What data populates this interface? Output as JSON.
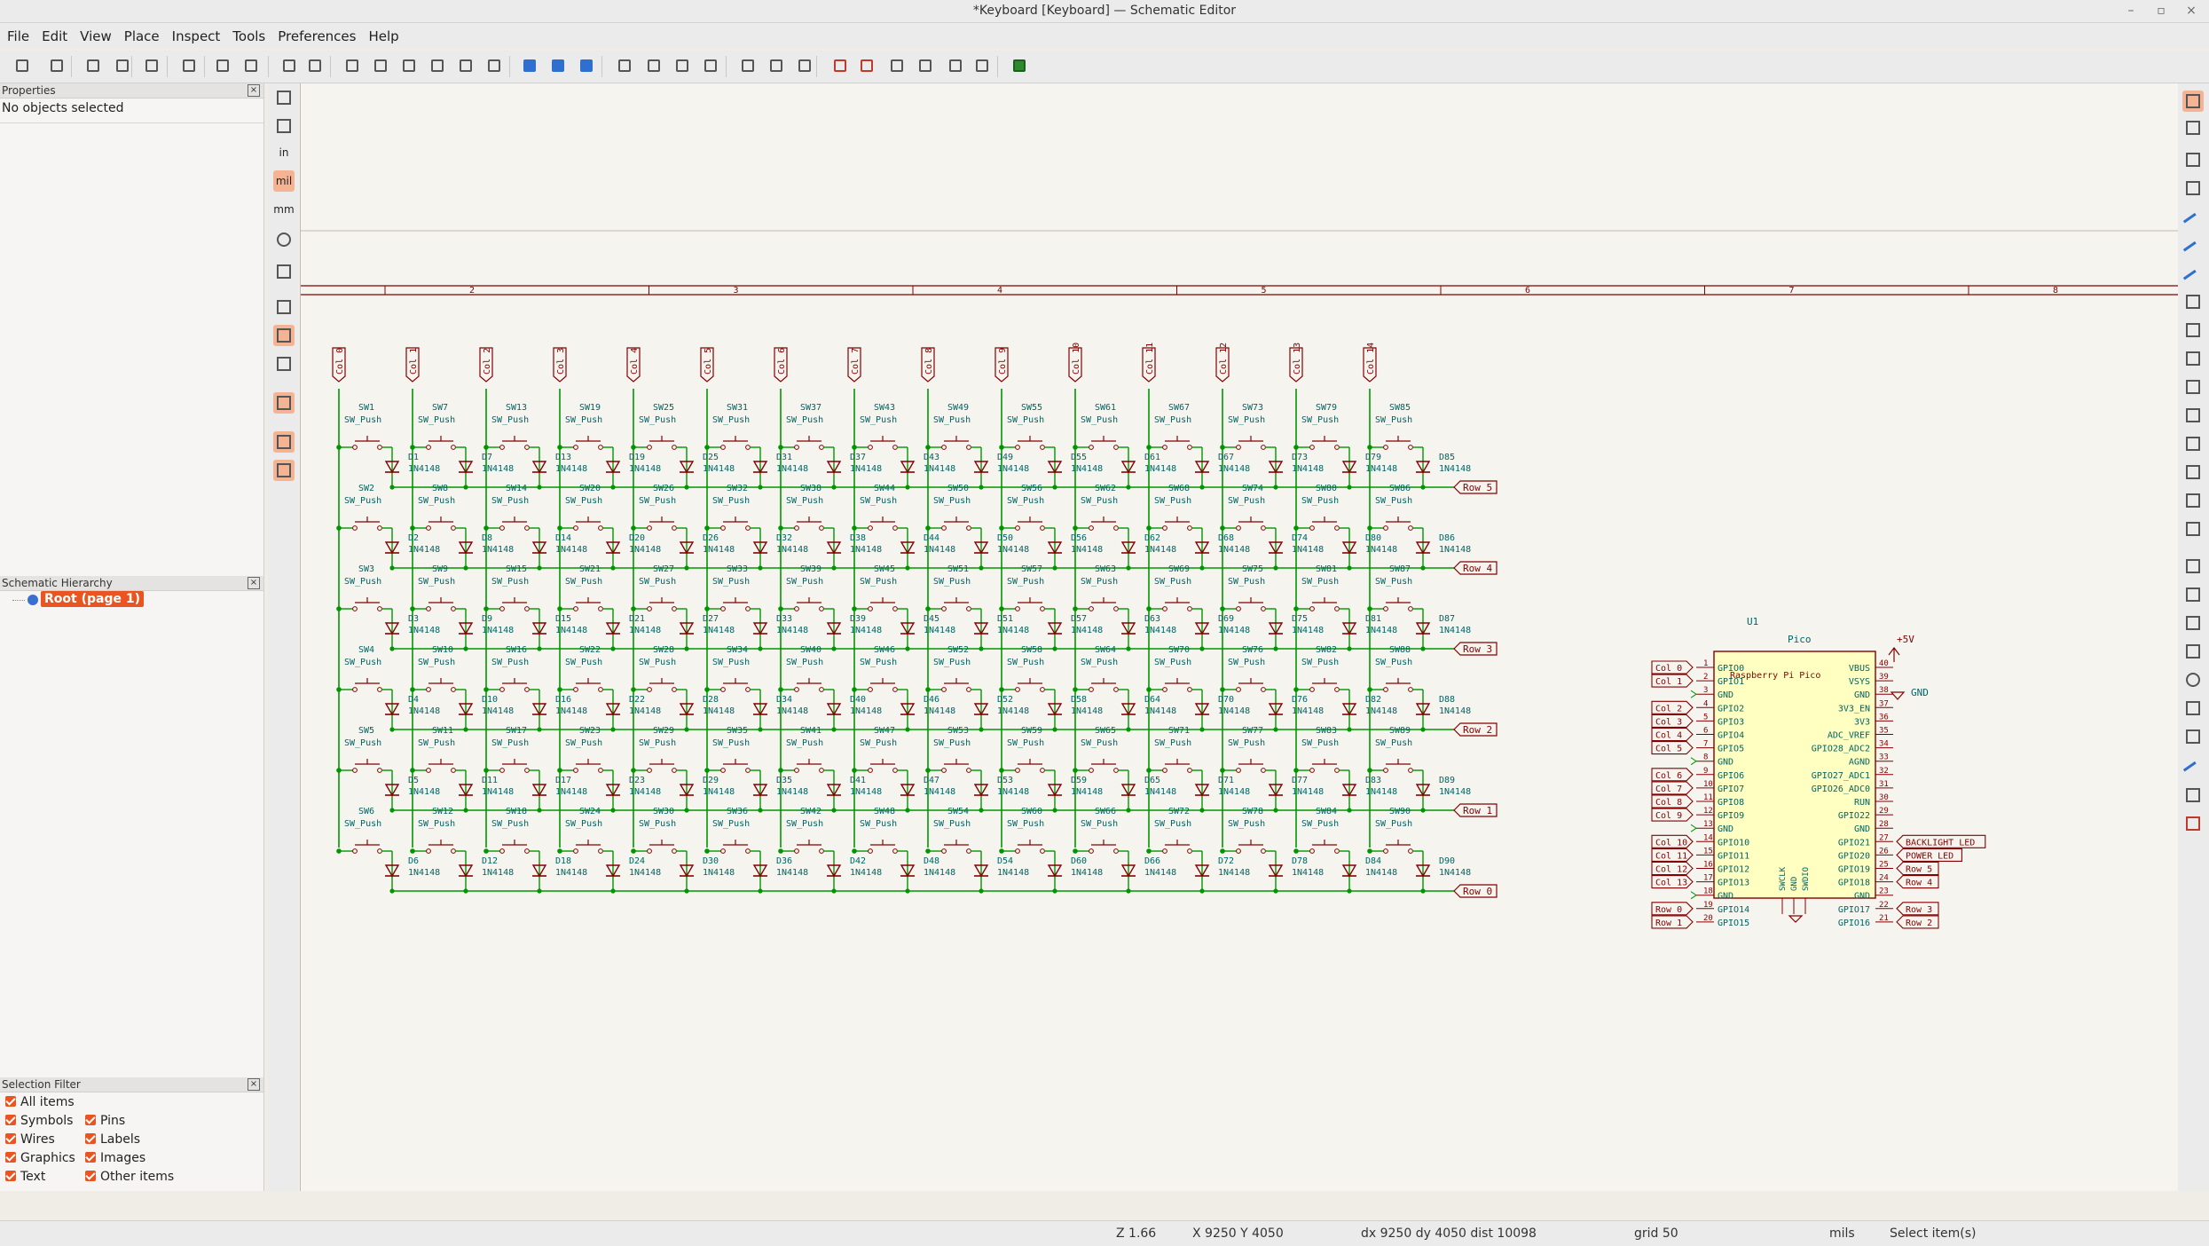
{
  "window": {
    "title": "*Keyboard [Keyboard] — Schematic Editor",
    "controls": [
      "–",
      "▫",
      "×"
    ]
  },
  "menu": [
    "File",
    "Edit",
    "View",
    "Place",
    "Inspect",
    "Tools",
    "Preferences",
    "Help"
  ],
  "properties": {
    "header": "Properties",
    "empty_text": "No objects selected"
  },
  "hierarchy": {
    "header": "Schematic Hierarchy",
    "root_label": "Root (page 1)"
  },
  "selection_filter": {
    "header": "Selection Filter",
    "items": [
      "All items",
      "Symbols",
      "Pins",
      "Wires",
      "Labels",
      "Graphics",
      "Images",
      "Text",
      "Other items"
    ]
  },
  "left_tools": {
    "units": [
      "in",
      "mil",
      "mm"
    ]
  },
  "sheet": {
    "column_labels": [
      "2",
      "3",
      "4",
      "5",
      "6",
      "7",
      "8"
    ]
  },
  "matrix": {
    "col_labels": [
      "Col 0",
      "Col 1",
      "Col 2",
      "Col 3",
      "Col 4",
      "Col 5",
      "Col 6",
      "Col 7",
      "Col 8",
      "Col 9",
      "Col 10",
      "Col 11",
      "Col 12",
      "Col 13",
      "Col 14"
    ],
    "row_labels": [
      "Row 5",
      "Row 4",
      "Row 3",
      "Row 2",
      "Row 1",
      "Row 0"
    ],
    "switch_value": "SW_Push",
    "diode_value": "1N4148"
  },
  "mcu": {
    "ref": "U1",
    "value": "Pico",
    "body_text": "Raspberry Pi Pico",
    "power_label": "+5V",
    "gnd_label": "GND",
    "left_pins": [
      {
        "num": "1",
        "name": "GPIO0",
        "net": "Col 0"
      },
      {
        "num": "2",
        "name": "GPIO1",
        "net": "Col 1"
      },
      {
        "num": "3",
        "name": "GND",
        "net": ""
      },
      {
        "num": "4",
        "name": "GPIO2",
        "net": "Col 2"
      },
      {
        "num": "5",
        "name": "GPIO3",
        "net": "Col 3"
      },
      {
        "num": "6",
        "name": "GPIO4",
        "net": "Col 4"
      },
      {
        "num": "7",
        "name": "GPIO5",
        "net": "Col 5"
      },
      {
        "num": "8",
        "name": "GND",
        "net": ""
      },
      {
        "num": "9",
        "name": "GPIO6",
        "net": "Col 6"
      },
      {
        "num": "10",
        "name": "GPIO7",
        "net": "Col 7"
      },
      {
        "num": "11",
        "name": "GPIO8",
        "net": "Col 8"
      },
      {
        "num": "12",
        "name": "GPIO9",
        "net": "Col 9"
      },
      {
        "num": "13",
        "name": "GND",
        "net": ""
      },
      {
        "num": "14",
        "name": "GPIO10",
        "net": "Col 10"
      },
      {
        "num": "15",
        "name": "GPIO11",
        "net": "Col 11"
      },
      {
        "num": "16",
        "name": "GPIO12",
        "net": "Col 12"
      },
      {
        "num": "17",
        "name": "GPIO13",
        "net": "Col 13"
      },
      {
        "num": "18",
        "name": "GND",
        "net": ""
      },
      {
        "num": "19",
        "name": "GPIO14",
        "net": "Row 0"
      },
      {
        "num": "20",
        "name": "GPIO15",
        "net": "Row 1"
      }
    ],
    "right_pins": [
      {
        "num": "40",
        "name": "VBUS",
        "net": ""
      },
      {
        "num": "39",
        "name": "VSYS",
        "net": ""
      },
      {
        "num": "38",
        "name": "GND",
        "net": ""
      },
      {
        "num": "37",
        "name": "3V3_EN",
        "net": ""
      },
      {
        "num": "36",
        "name": "3V3",
        "net": ""
      },
      {
        "num": "35",
        "name": "ADC_VREF",
        "net": ""
      },
      {
        "num": "34",
        "name": "GPIO28_ADC2",
        "net": ""
      },
      {
        "num": "33",
        "name": "AGND",
        "net": ""
      },
      {
        "num": "32",
        "name": "GPIO27_ADC1",
        "net": ""
      },
      {
        "num": "31",
        "name": "GPIO26_ADC0",
        "net": ""
      },
      {
        "num": "30",
        "name": "RUN",
        "net": ""
      },
      {
        "num": "29",
        "name": "GPIO22",
        "net": ""
      },
      {
        "num": "28",
        "name": "GND",
        "net": ""
      },
      {
        "num": "27",
        "name": "GPIO21",
        "net": "BACKLIGHT LED"
      },
      {
        "num": "26",
        "name": "GPIO20",
        "net": "POWER LED"
      },
      {
        "num": "25",
        "name": "GPIO19",
        "net": "Row 5"
      },
      {
        "num": "24",
        "name": "GPIO18",
        "net": "Row 4"
      },
      {
        "num": "23",
        "name": "GND",
        "net": ""
      },
      {
        "num": "22",
        "name": "GPIO17",
        "net": "Row 3"
      },
      {
        "num": "21",
        "name": "GPIO16",
        "net": "Row 2"
      }
    ],
    "bottom_pins": [
      "SWCLK",
      "GND",
      "SWDIO"
    ]
  },
  "status": {
    "zoom": "Z 1.66",
    "cursor": "X 9250  Y 4050",
    "delta": "dx 9250  dy 4050  dist 10098",
    "grid": "grid 50",
    "units": "mils",
    "mode": "Select item(s)"
  },
  "colors": {
    "canvas_bg": "#f5f4ef",
    "wire": "#009600",
    "symbol": "#840000",
    "text": "#006464",
    "junction": "#009600",
    "sheet_border": "#840000",
    "accent": "#e95420"
  },
  "icons": {
    "toolbar": [
      "save-icon",
      "schematic-setup-icon",
      "page-settings-icon",
      "print-icon",
      "plot-icon",
      "paste-icon",
      "undo-icon",
      "redo-icon",
      "find-icon",
      "find-replace-icon",
      "refresh-icon",
      "zoom-in-icon",
      "zoom-out-icon",
      "zoom-fit-icon",
      "zoom-objects-icon",
      "zoom-tool-icon",
      "navigate-back-icon",
      "navigate-up-icon",
      "navigate-forward-icon",
      "rotate-ccw-icon",
      "rotate-cw-icon",
      "mirror-v-icon",
      "mirror-h-icon",
      "symbol-editor-icon",
      "symbol-library-icon",
      "annotate-icon",
      "erc-icon",
      "symbol-fields-icon",
      "bom-icon",
      "netlist-icon",
      "footprint-assign-icon",
      "simulator-icon",
      "pcb-editor-icon"
    ],
    "right": [
      "select-icon",
      "highlight-net-icon",
      "add-symbol-icon",
      "add-power-icon",
      "add-wire-icon",
      "add-bus-icon",
      "wire-entry-icon",
      "no-connect-icon",
      "junction-icon",
      "net-label-icon",
      "net-class-icon",
      "rule-area-icon",
      "global-label-icon",
      "hier-label-icon",
      "sheet-icon",
      "import-sheet-pin-icon",
      "text-icon",
      "textbox-icon",
      "table-icon",
      "rectangle-icon",
      "circle-icon",
      "arc-icon",
      "bezier-icon",
      "line-icon",
      "image-icon",
      "delete-icon"
    ]
  }
}
